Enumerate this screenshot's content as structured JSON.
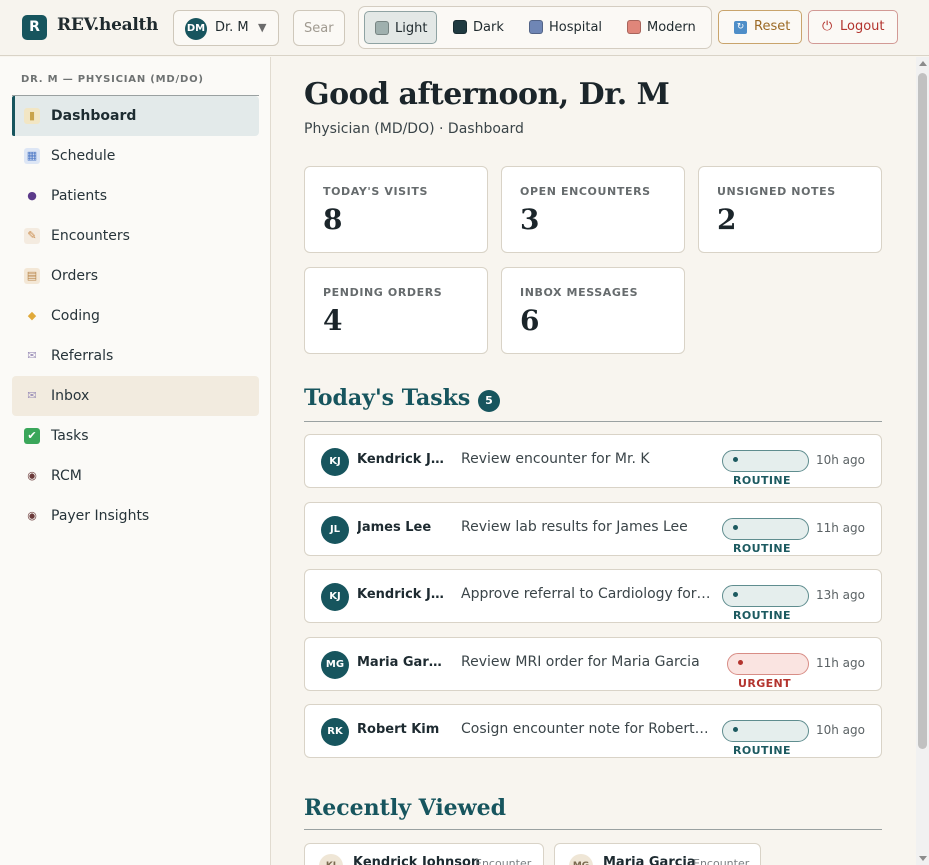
{
  "header": {
    "logo_letter": "R",
    "brand": "REV.health",
    "user": {
      "initials": "DM",
      "name": "Dr. M"
    },
    "search_placeholder": "Search",
    "themes": [
      {
        "label": "Light",
        "color": "#9fb0ae",
        "active": true
      },
      {
        "label": "Dark",
        "color": "#1f3a40",
        "active": false
      },
      {
        "label": "Hospital",
        "color": "#6f86b5",
        "active": false
      },
      {
        "label": "Modern",
        "color": "#e0867a",
        "active": false
      }
    ],
    "reset_label": "Reset",
    "logout_label": "Logout"
  },
  "sidebar": {
    "heading": "DR. M — PHYSICIAN (MD/DO)",
    "items": [
      {
        "label": "Dashboard",
        "icon": "bar-chart-icon",
        "glyph": "▮",
        "color": "#c9a34a"
      },
      {
        "label": "Schedule",
        "icon": "calendar-icon",
        "glyph": "▦",
        "color": "#4e79c6"
      },
      {
        "label": "Patients",
        "icon": "person-icon",
        "glyph": "●",
        "color": "#5b3a8a"
      },
      {
        "label": "Encounters",
        "icon": "memo-icon",
        "glyph": "✎",
        "color": "#c98a4a"
      },
      {
        "label": "Orders",
        "icon": "clipboard-icon",
        "glyph": "▤",
        "color": "#b8864a"
      },
      {
        "label": "Coding",
        "icon": "tag-icon",
        "glyph": "◆",
        "color": "#e0a93a"
      },
      {
        "label": "Referrals",
        "icon": "envelope-icon",
        "glyph": "✉",
        "color": "#9b8fb8"
      },
      {
        "label": "Inbox",
        "icon": "inbox-icon",
        "glyph": "✉",
        "color": "#9b8fb8"
      },
      {
        "label": "Tasks",
        "icon": "check-icon",
        "glyph": "✔",
        "color": "#3aa65a"
      },
      {
        "label": "RCM",
        "icon": "eye-icon",
        "glyph": "◉",
        "color": "#6a3a3a"
      },
      {
        "label": "Payer Insights",
        "icon": "eye-icon",
        "glyph": "◉",
        "color": "#6a3a3a"
      }
    ]
  },
  "main": {
    "greeting": "Good afternoon, Dr. M",
    "subtitle": "Physician (MD/DO) · Dashboard",
    "stats": [
      {
        "label": "TODAY'S VISITS",
        "value": "8"
      },
      {
        "label": "OPEN ENCOUNTERS",
        "value": "3"
      },
      {
        "label": "UNSIGNED NOTES",
        "value": "2"
      },
      {
        "label": "PENDING ORDERS",
        "value": "4"
      },
      {
        "label": "INBOX MESSAGES",
        "value": "6"
      }
    ],
    "tasks_title": "Today's Tasks",
    "tasks_count": "5",
    "tasks": [
      {
        "initials": "KJ",
        "name": "Kendrick Johnson",
        "desc": "Review encounter for Mr. K",
        "priority": "ROUTINE",
        "ago": "10h ago"
      },
      {
        "initials": "JL",
        "name": "James Lee",
        "desc": "Review lab results for James Lee",
        "priority": "ROUTINE",
        "ago": "11h ago"
      },
      {
        "initials": "KJ",
        "name": "Kendrick Johnson",
        "desc": "Approve referral to Cardiology for Mr. K",
        "priority": "ROUTINE",
        "ago": "13h ago"
      },
      {
        "initials": "MG",
        "name": "Maria Garcia",
        "desc": "Review MRI order for Maria Garcia",
        "priority": "URGENT",
        "ago": "11h ago"
      },
      {
        "initials": "RK",
        "name": "Robert Kim",
        "desc": "Cosign encounter note for Robert Kim",
        "priority": "ROUTINE",
        "ago": "10h ago"
      }
    ],
    "recent_title": "Recently Viewed",
    "recent": [
      {
        "initials": "KJ",
        "name": "Kendrick Johnson",
        "type": "Encounter"
      },
      {
        "initials": "MG",
        "name": "Maria Garcia",
        "type": "Encounter"
      }
    ]
  }
}
